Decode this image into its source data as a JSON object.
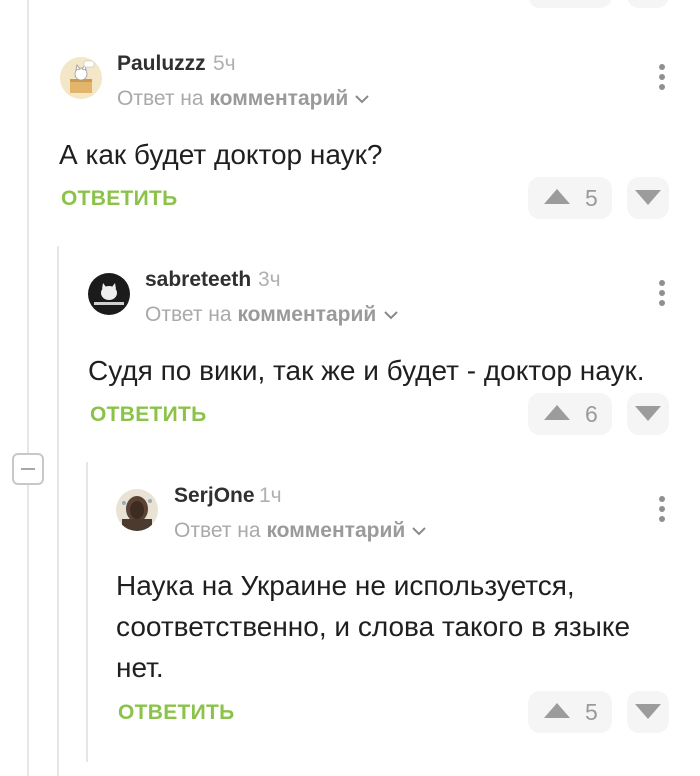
{
  "comments": [
    {
      "author": "Pauluzzz",
      "time": "5ч",
      "reply_prefix": "Ответ на",
      "reply_target": "комментарий",
      "text": "А как будет доктор наук?",
      "reply_label": "ОТВЕТИТЬ",
      "votes": "5",
      "avatar_icon": "cat-in-box-avatar"
    },
    {
      "author": "sabreteeth",
      "time": "3ч",
      "reply_prefix": "Ответ на",
      "reply_target": "комментарий",
      "text": "Судя по вики, так же и будет - доктор наук.",
      "reply_label": "ОТВЕТИТЬ",
      "votes": "6",
      "avatar_icon": "white-cat-avatar"
    },
    {
      "author": "SerjOne",
      "time": "1ч",
      "reply_prefix": "Ответ на",
      "reply_target": "комментарий",
      "text_lines": [
        "Наука на Украине не используется,",
        "соответственно, и слова такого в языке",
        "нет."
      ],
      "reply_label": "ОТВЕТИТЬ",
      "votes": "5",
      "avatar_icon": "dark-portrait-avatar"
    }
  ],
  "colors": {
    "accent": "#8bc34a",
    "muted": "#a9a9a9",
    "vote_bg": "#f5f5f5"
  }
}
